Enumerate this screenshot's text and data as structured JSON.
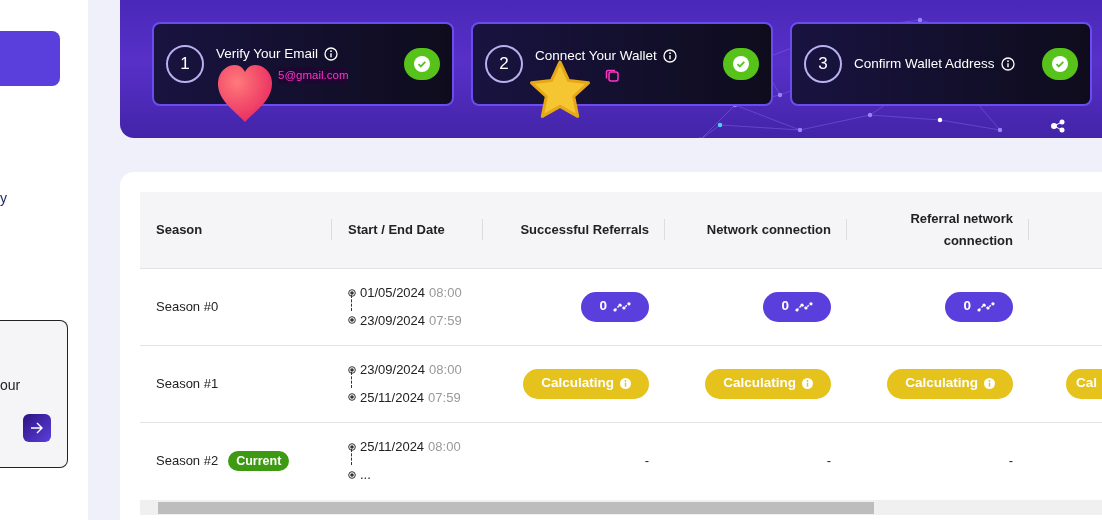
{
  "sidebar": {
    "active_item": {
      "selected": true
    },
    "link_fragment": "y",
    "promo_card": {
      "text_fragment": "our"
    }
  },
  "steps": [
    {
      "number": "1",
      "title": "Verify Your Email",
      "email": "5@gmail.com",
      "done": true,
      "sticker": {
        "kind": "heart"
      }
    },
    {
      "number": "2",
      "title": "Connect Your Wallet",
      "copy_button": true,
      "done": true,
      "sticker": {
        "kind": "star"
      }
    },
    {
      "number": "3",
      "title": "Confirm Wallet Address",
      "done": true
    }
  ],
  "table": {
    "columns": [
      "Season",
      "Start / End Date",
      "Successful Referrals",
      "Network connection",
      "Referral network connection"
    ],
    "rows": [
      {
        "cells": [
          {
            "kind": "season",
            "text": "Season #0"
          },
          {
            "kind": "dates",
            "start_date": "01/05/2024",
            "start_time": "08:00",
            "end_date": "23/09/2024",
            "end_time": "07:59"
          },
          {
            "kind": "count",
            "text": "0"
          },
          {
            "kind": "count",
            "text": "0"
          },
          {
            "kind": "count",
            "text": "0"
          }
        ]
      },
      {
        "cells": [
          {
            "kind": "season",
            "text": "Season #1"
          },
          {
            "kind": "dates",
            "start_date": "23/09/2024",
            "start_time": "08:00",
            "end_date": "25/11/2024",
            "end_time": "07:59"
          },
          {
            "kind": "calculating",
            "text": "Calculating"
          },
          {
            "kind": "calculating",
            "text": "Calculating"
          },
          {
            "kind": "calculating",
            "text": "Calculating"
          },
          {
            "kind": "calculating",
            "text": "Cal"
          }
        ]
      },
      {
        "cells": [
          {
            "kind": "season",
            "text": "Season #2",
            "badge": "Current"
          },
          {
            "kind": "dates",
            "start_date": "25/11/2024",
            "start_time": "08:00",
            "end_date": "..."
          },
          {
            "kind": "empty",
            "text": "-"
          },
          {
            "kind": "empty",
            "text": "-"
          },
          {
            "kind": "empty",
            "text": "-"
          }
        ]
      }
    ]
  }
}
